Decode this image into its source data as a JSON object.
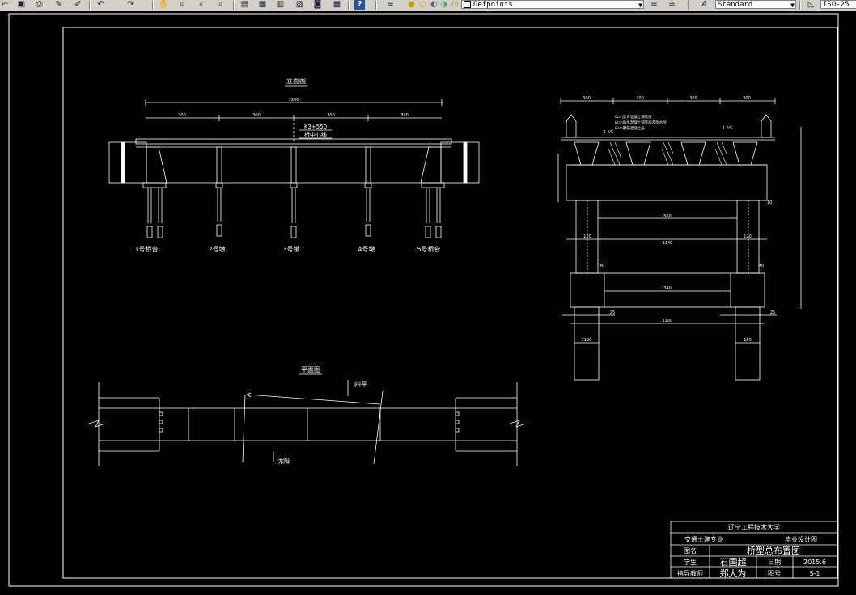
{
  "toolbar": {
    "layer_name": "Defpoints",
    "text_style": "Standard",
    "dim_style": "ISO-25",
    "help_label": "?"
  },
  "drawing": {
    "elevation": {
      "title": "立面图",
      "total_span": "1200",
      "spans": [
        "300",
        "300",
        "300",
        "300"
      ],
      "station": "K3+550",
      "center_label": "桥中心线",
      "pier_labels": [
        "1号桥台",
        "2号墩",
        "3号墩",
        "4号墩",
        "5号桥台"
      ]
    },
    "plan": {
      "title": "平面图",
      "north_label": "四平",
      "south_label": "沈阳"
    },
    "section": {
      "top_dims": [
        "300",
        "300",
        "300",
        "300"
      ],
      "notes": [
        "6cm沥青混凝土铺装层",
        "8cm防水混凝土铺装层及防水层",
        "8cm钢筋混凝土层"
      ],
      "slope_left": "1.5%",
      "slope_right": "1.5%",
      "dim_500": "500",
      "dim_120_left": "120",
      "dim_120_right": "120",
      "dim_1140": "1140",
      "dim_40_left": "40",
      "dim_40_right": "40",
      "dim_340": "340",
      "dim_25_left": "25",
      "dim_25_right": "25",
      "dim_1100": "1100",
      "dim_1120": "1120",
      "dim_150": "150",
      "dim_10": "10"
    },
    "title_block": {
      "school": "辽宁工程技术大学",
      "major": "交通土建专业",
      "design": "毕业设计图",
      "name_label": "图名",
      "name_value": "桥型总布置图",
      "student_label": "学生",
      "student_value": "石国超",
      "date_label": "日期",
      "date_value": "2015.6",
      "advisor_label": "指导教师",
      "advisor_value": "郑大为",
      "sheet_label": "图号",
      "sheet_value": "S-1"
    }
  }
}
